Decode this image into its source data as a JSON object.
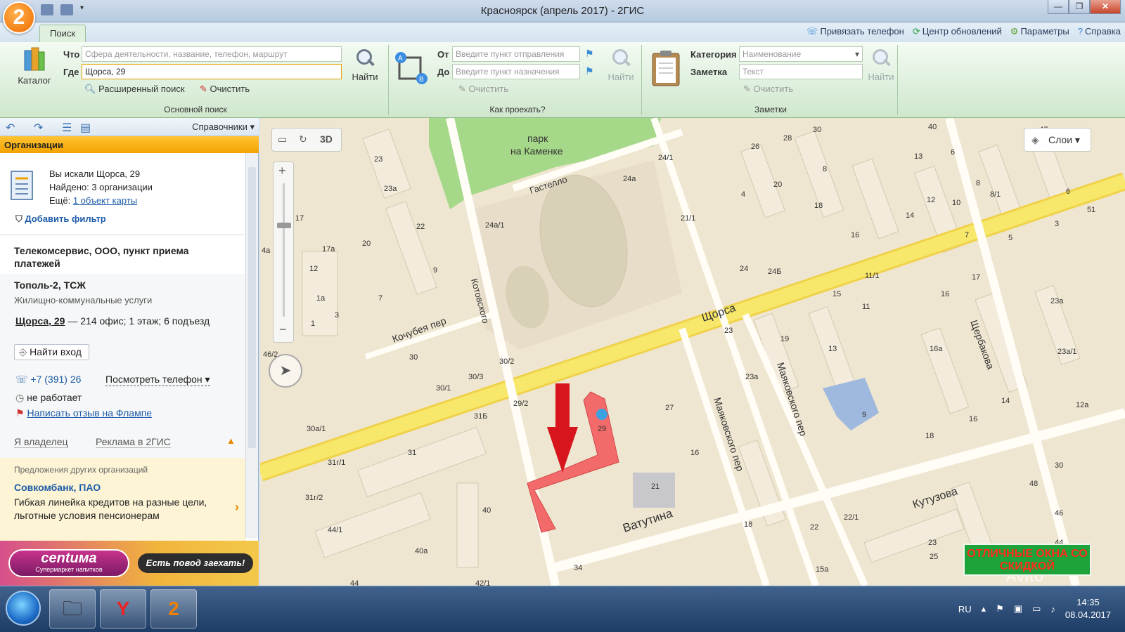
{
  "window": {
    "title": "Красноярск (апрель 2017) - 2ГИС",
    "logo": "2"
  },
  "ribbon": {
    "tab_label": "Поиск",
    "top_links": [
      "Привязать телефон",
      "Центр обновлений",
      "Параметры",
      "Справка"
    ],
    "catalog_label": "Каталог",
    "main_search": {
      "what_label": "Что",
      "what_placeholder": "Сфера деятельности, название, телефон, маршрут",
      "where_label": "Где",
      "where_value": "Щорса, 29",
      "find_label": "Найти",
      "advanced_label": "Расширенный поиск",
      "clear_label": "Очистить",
      "group_title": "Основной поиск"
    },
    "route": {
      "from_label": "От",
      "from_placeholder": "Введите пункт отправления",
      "to_label": "До",
      "to_placeholder": "Введите пункт назначения",
      "clear_label": "Очистить",
      "find_label": "Найти",
      "group_title": "Как проехать?"
    },
    "notes": {
      "category_label": "Категория",
      "category_placeholder": "Наименование",
      "note_label": "Заметка",
      "note_placeholder": "Текст",
      "clear_label": "Очистить",
      "find_label": "Найти",
      "group_title": "Заметки"
    }
  },
  "left": {
    "handbooks_label": "Справочники",
    "orgs_header": "Организации",
    "summary": {
      "searched": "Вы искали Щорса, 29",
      "found": "Найдено: 3 организации",
      "more_prefix": "Ещё:",
      "more_link": "1 объект карты",
      "add_filter": "Добавить фильтр"
    },
    "result1_title": "Телекомсервис, ООО, пункт приема платежей",
    "result2": {
      "title": "Тополь-2, ТСЖ",
      "category": "Жилищно-коммунальные услуги",
      "address_bold": "Щорса, 29",
      "address_rest": "— 214 офис; 1 этаж; 6 подъезд",
      "find_entrance": "Найти вход",
      "phone": "+7 (391) 26",
      "show_phone": "Посмотреть телефон",
      "status": "не работает",
      "review_link": "Написать отзыв на Флампе",
      "owner_link": "Я владелец",
      "ads_link": "Реклама в 2ГИС"
    },
    "offers": {
      "heading": "Предложения других организаций",
      "company": "Совкомбанк, ПАО",
      "text": "Гибкая линейка кредитов на разные цели, льготные условия пенсионерам"
    },
    "promo": {
      "brand": "centuма",
      "tagline": "Супермаркет напитков",
      "slogan": "Есть повод заехать!"
    }
  },
  "map": {
    "tools_3d": "3D",
    "layers_label": "Слои",
    "ad_text": "ОТЛИЧНЫЕ ОКНА СО СКИДКОЙ",
    "park_label": "парк на Каменке",
    "streets": [
      "Щорса",
      "Гастелло",
      "Котовского",
      "Кочубея пер",
      "Маяковского пер",
      "Щербакова",
      "Ватутина",
      "Кутузова",
      "Маяковского пер"
    ],
    "house_numbers": [
      "23",
      "23а",
      "17",
      "17а",
      "20",
      "22",
      "12",
      "1а",
      "1",
      "3",
      "9",
      "7",
      "30",
      "30/3",
      "30/2",
      "30/1",
      "30a/1",
      "31Б",
      "29/2",
      "29",
      "27",
      "21",
      "16",
      "18",
      "22",
      "22/1",
      "23",
      "24",
      "24Б",
      "24/1",
      "24а",
      "24а/1",
      "21/1",
      "26",
      "28",
      "30",
      "4",
      "8",
      "20",
      "18",
      "16",
      "15",
      "11",
      "11/1",
      "13",
      "19",
      "16а",
      "23а",
      "13",
      "6",
      "8",
      "10",
      "12",
      "14",
      "5",
      "7",
      "3",
      "17",
      "16",
      "23а",
      "18",
      "14",
      "16",
      "30",
      "48",
      "46",
      "44",
      "25",
      "23",
      "22",
      "15а",
      "34",
      "40",
      "40а",
      "44/1",
      "31",
      "31г/1",
      "31г/2",
      "9",
      "47",
      "40",
      "6",
      "8/1",
      "51",
      "12а",
      "23а/1",
      "46/2",
      "42/1",
      "44"
    ],
    "watermark": "Avito"
  },
  "taskbar": {
    "lang": "RU",
    "time": "14:35",
    "date": "08.04.2017"
  },
  "colors": {
    "ribbon_green": "#d8eed6",
    "orgs_header": "#f6b300",
    "road_yellow": "#f5e64a",
    "building_highlight": "#f36a6a",
    "arrow_red": "#d8151c"
  }
}
